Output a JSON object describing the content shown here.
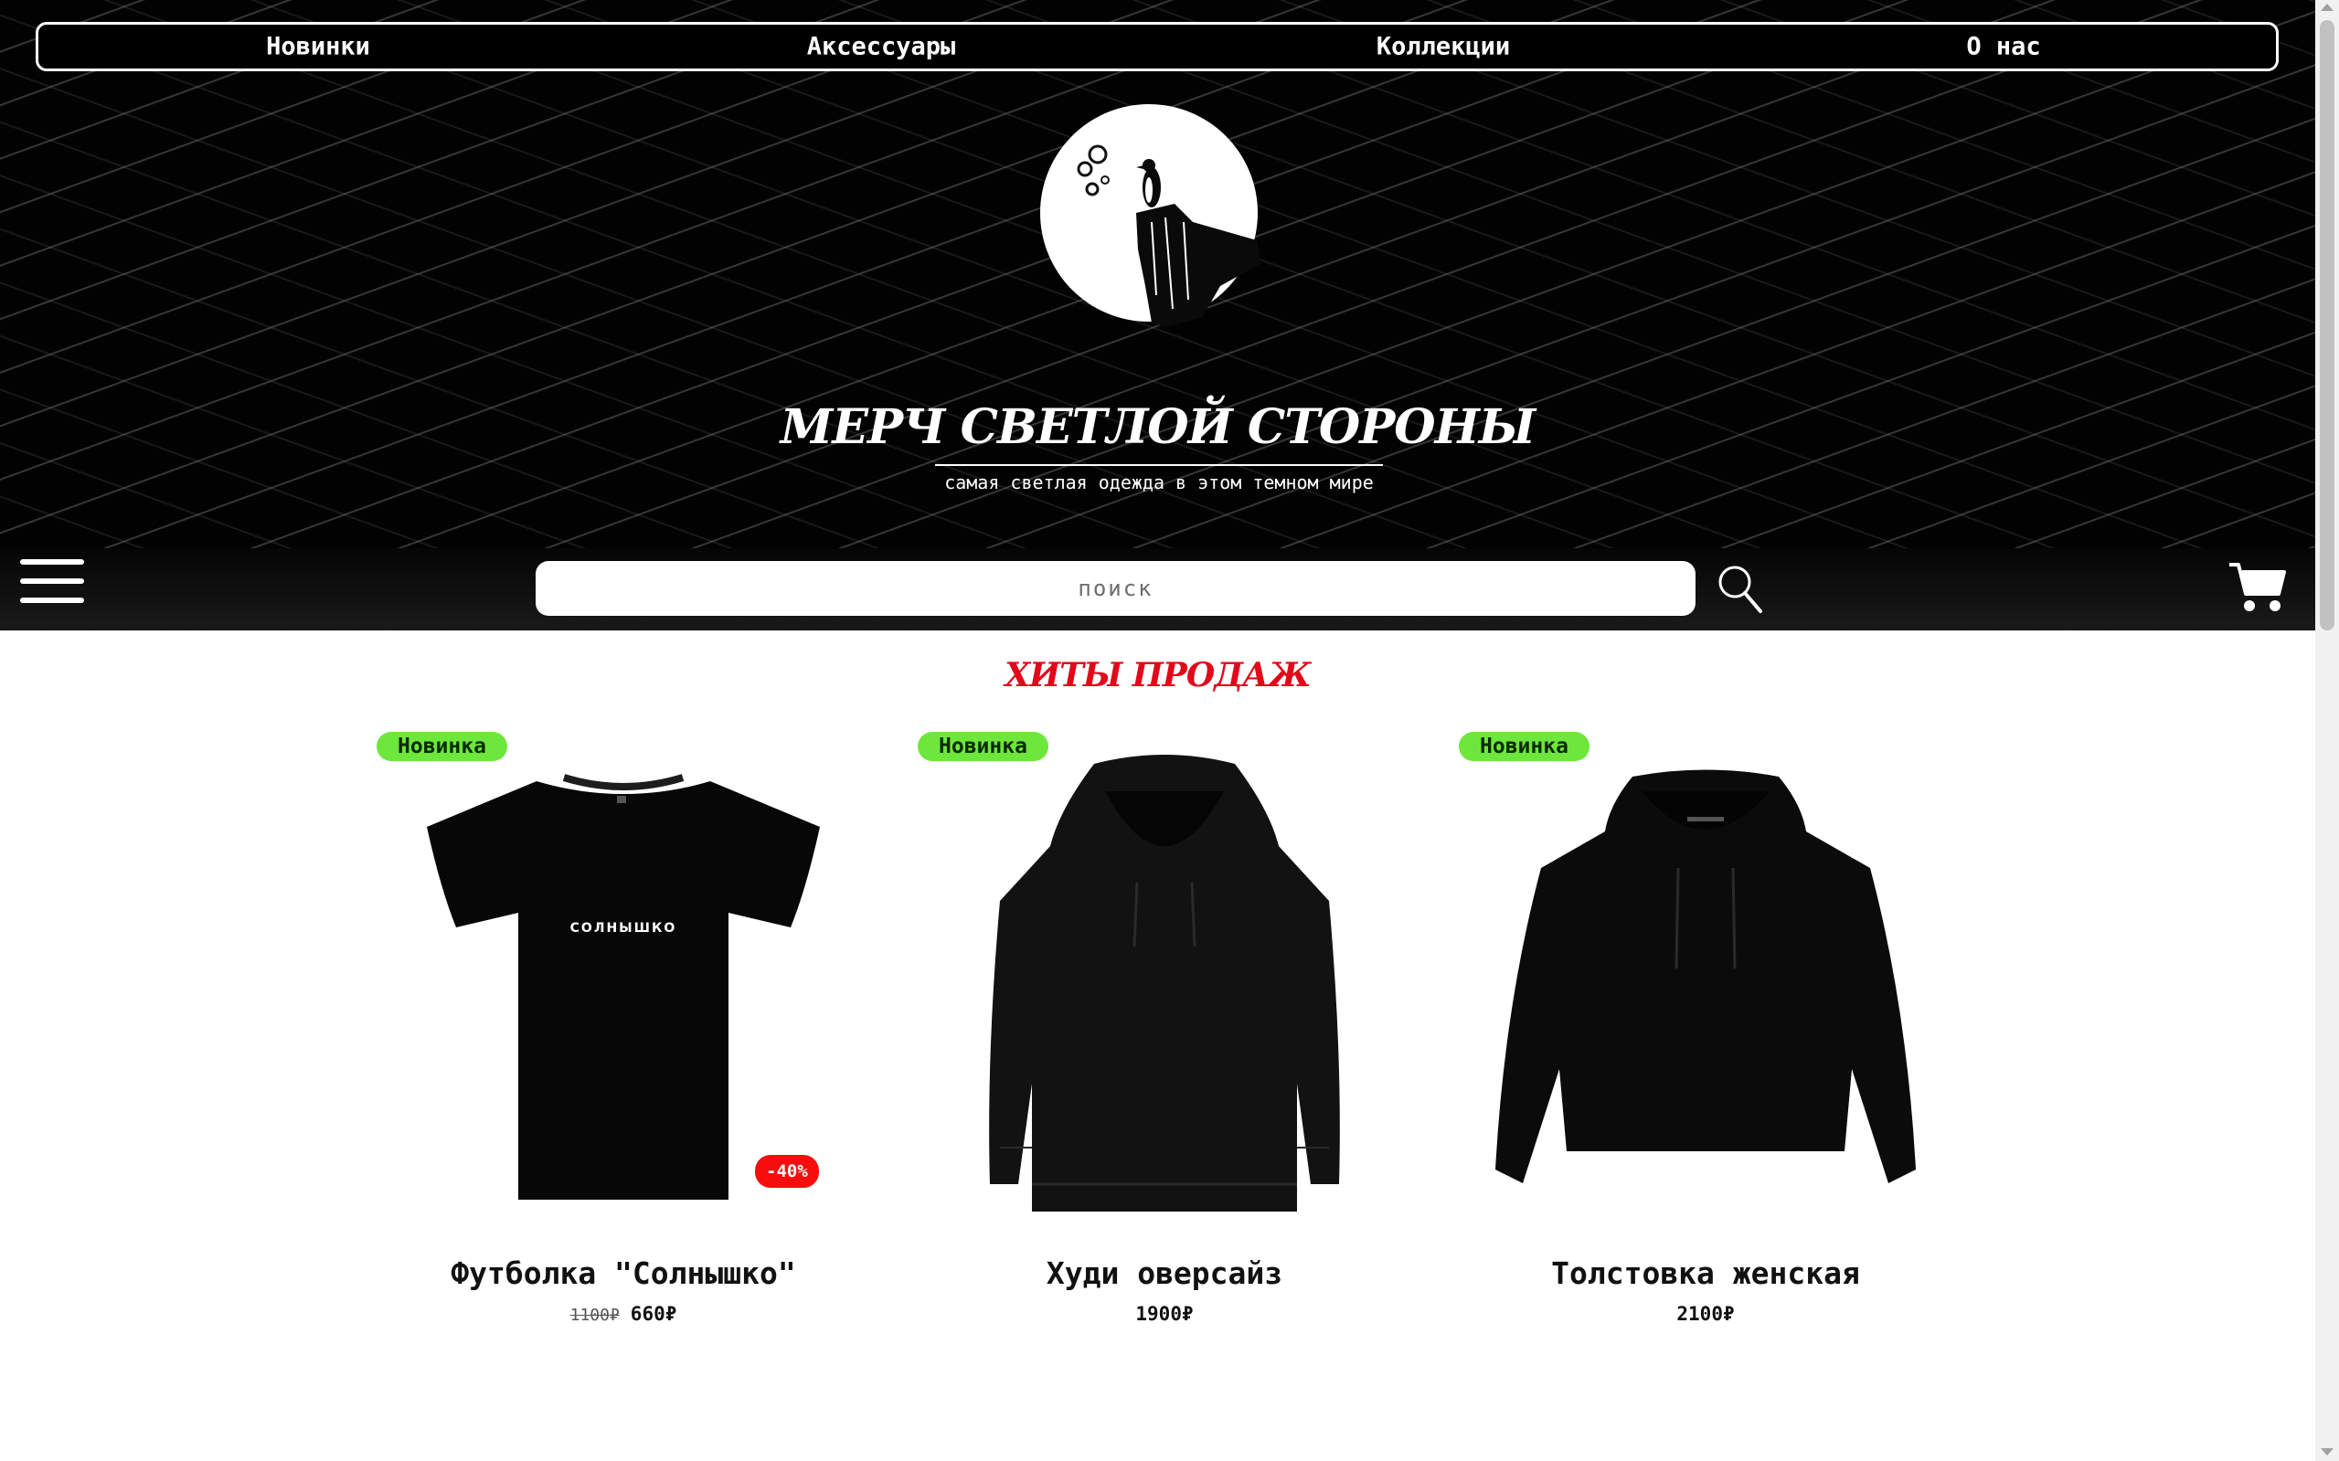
{
  "nav": {
    "items": [
      "Новинки",
      "Аксессуары",
      "Коллекции",
      "О нас"
    ]
  },
  "brand": {
    "title": "МЕРЧ СВЕТЛОЙ СТОРОНЫ",
    "subtitle": "самая светлая одежда в этом темном мире"
  },
  "toolbar": {
    "search_placeholder": "поиск",
    "icons": [
      "menu-icon",
      "search-icon",
      "cart-icon"
    ]
  },
  "section": {
    "title": "ХИТЫ ПРОДАЖ"
  },
  "products": [
    {
      "badge": "Новинка",
      "discount": "-40%",
      "image_text": "СОЛНЫШКО",
      "name": "Футболка \"Солнышко\"",
      "old_price": "1100₽",
      "price": "660₽"
    },
    {
      "badge": "Новинка",
      "name": "Худи оверсайз",
      "price": "1900₽"
    },
    {
      "badge": "Новинка",
      "name": "Толстовка женская",
      "price": "2100₽"
    }
  ],
  "colors": {
    "accent_red": "#e1081a",
    "badge_green": "#6ee73c",
    "discount_red": "#f70d0d",
    "header_bg": "#020202"
  }
}
